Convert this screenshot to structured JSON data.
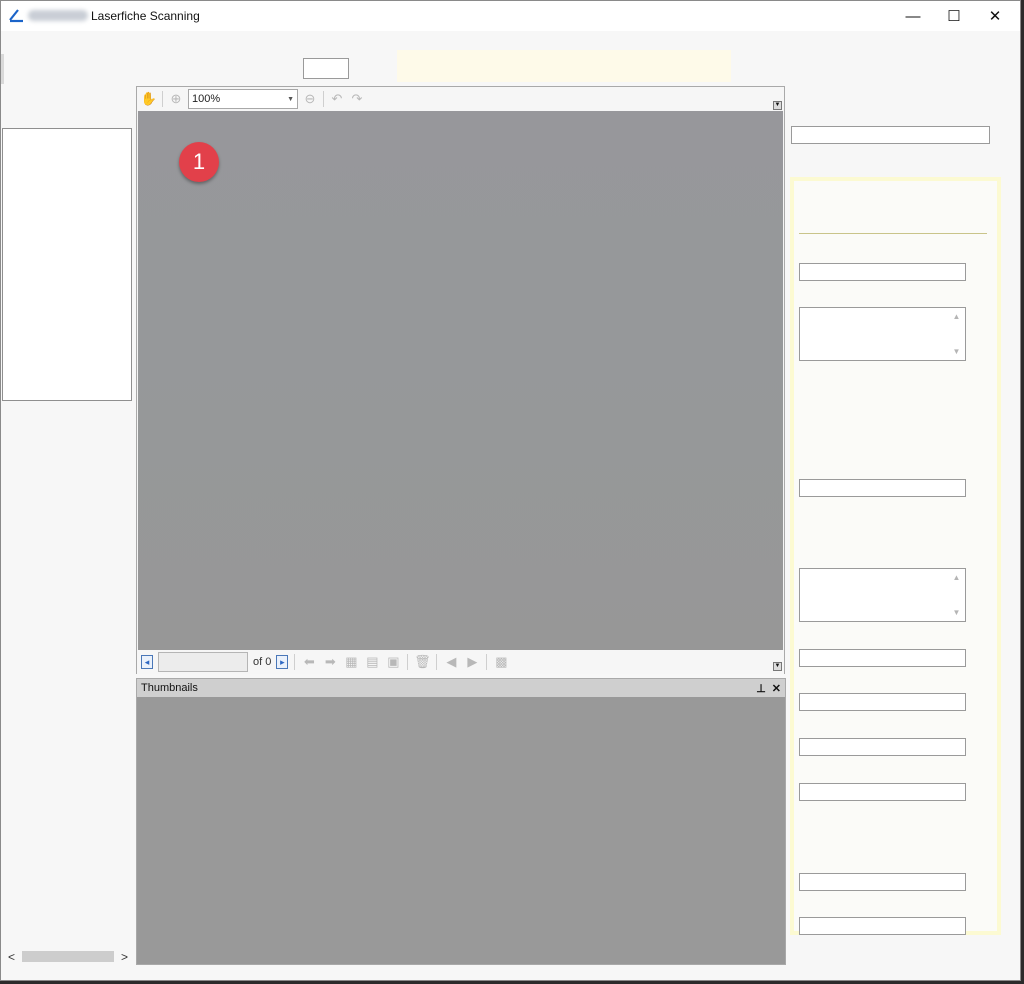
{
  "window": {
    "title": "Laserfiche Scanning",
    "controls": {
      "minimize": "—",
      "maximize": "☐",
      "close": "✕"
    }
  },
  "viewer": {
    "zoom": "100%",
    "page_of": "of 0",
    "annotation_badge": "1",
    "icons": [
      "hand-tool",
      "zoom-in",
      "zoom-out",
      "rotate-left",
      "rotate-right"
    ]
  },
  "thumbnails": {
    "title": "Thumbnails",
    "pin": "⊥",
    "close": "✕"
  },
  "scrollbar": {
    "left": "<",
    "right": ">"
  },
  "colors": {
    "badge": "#e2404a",
    "canvas": "#979797",
    "metadata_border": "#fcfad2"
  }
}
